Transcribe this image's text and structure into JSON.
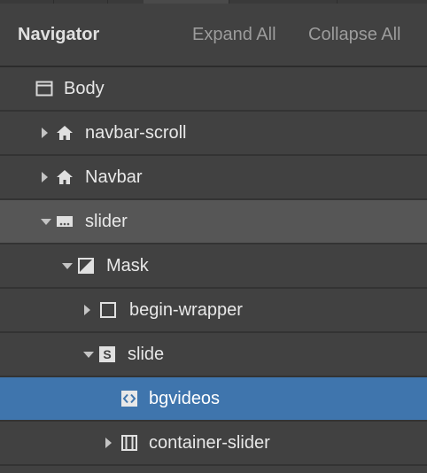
{
  "header": {
    "title": "Navigator",
    "expand_all": "Expand All",
    "collapse_all": "Collapse All"
  },
  "tree": [
    {
      "label": "Body",
      "icon": "body-icon",
      "caret": "none",
      "state": "normal"
    },
    {
      "label": "navbar-scroll",
      "icon": "home-icon",
      "caret": "collapsed",
      "state": "normal"
    },
    {
      "label": "Navbar",
      "icon": "home-icon",
      "caret": "collapsed",
      "state": "normal"
    },
    {
      "label": "slider",
      "icon": "slider-icon",
      "caret": "expanded",
      "state": "hover"
    },
    {
      "label": "Mask",
      "icon": "mask-icon",
      "caret": "expanded",
      "state": "normal"
    },
    {
      "label": "begin-wrapper",
      "icon": "div-block-icon",
      "caret": "collapsed",
      "state": "normal"
    },
    {
      "label": "slide",
      "icon": "slide-icon",
      "caret": "expanded",
      "state": "normal"
    },
    {
      "label": "bgvideos",
      "icon": "embed-icon",
      "caret": "none",
      "state": "selected"
    },
    {
      "label": "container-slider",
      "icon": "container-icon",
      "caret": "collapsed",
      "state": "normal"
    }
  ]
}
